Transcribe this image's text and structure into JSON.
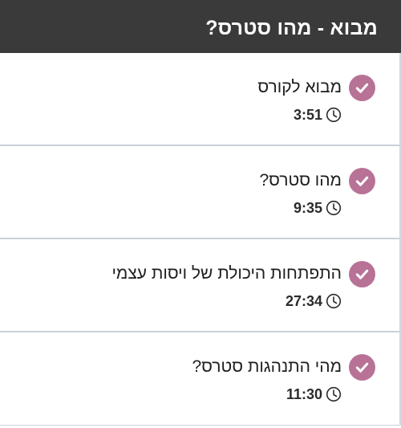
{
  "section": {
    "title": "מבוא - מהו סטרס?"
  },
  "lessons": [
    {
      "title": "מבוא לקורס",
      "duration": "3:51",
      "status": "completed",
      "icon": "check-circle-icon"
    },
    {
      "title": "מהו סטרס?",
      "duration": "9:35",
      "status": "completed",
      "icon": "check-circle-icon"
    },
    {
      "title": "התפתחות היכולת של ויסות עצמי",
      "duration": "27:34",
      "status": "completed",
      "icon": "check-circle-icon"
    },
    {
      "title": "מהי התנהגות סטרס?",
      "duration": "11:30",
      "status": "completed",
      "icon": "check-circle-icon"
    }
  ],
  "colors": {
    "header_bg": "#3a3a3a",
    "check_accent": "#b87296",
    "divider": "#c9d1db"
  }
}
